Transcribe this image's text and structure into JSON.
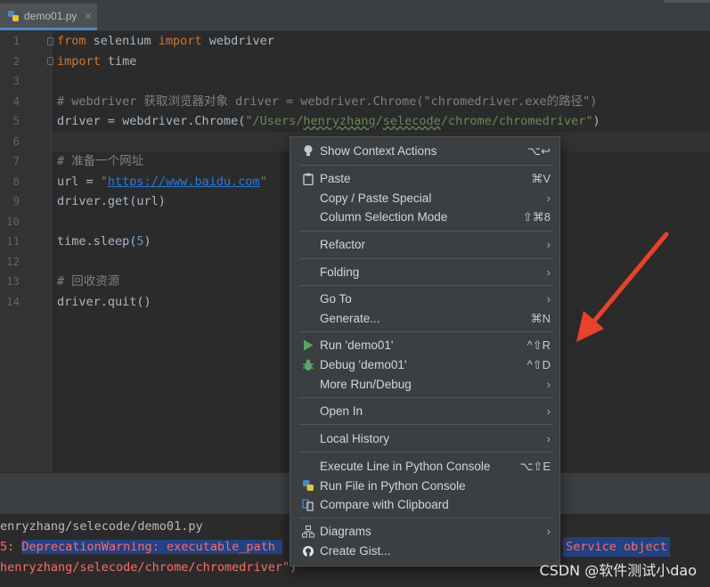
{
  "tab": {
    "filename": "demo01.py",
    "close": "×"
  },
  "lines": [
    "1",
    "2",
    "3",
    "4",
    "5",
    "6",
    "7",
    "8",
    "9",
    "10",
    "11",
    "12",
    "13",
    "14"
  ],
  "code": {
    "l1": {
      "kw1": "from",
      "mid": " selenium ",
      "kw2": "import",
      "rest": " webdriver"
    },
    "l2": {
      "kw1": "import",
      "rest": " time"
    },
    "l4": {
      "comment": "# webdriver 获取浏览器对象 driver = webdriver.Chrome(\"chromedriver.exe的路径\")"
    },
    "l5": {
      "pre": "driver = webdriver.Chrome(",
      "s1": "\"/Users/",
      "s2": "henryzhang",
      "s3": "/",
      "s4": "selecode",
      "s5": "/chrome/chromedriver\"",
      "post": ")"
    },
    "l7": {
      "comment": "# 准备一个网址"
    },
    "l8": {
      "pre": "url = ",
      "q1": "\"",
      "link": "https://www.baidu.com",
      "q2": "\""
    },
    "l9": {
      "text": "driver.get(url)"
    },
    "l11": {
      "pre": "time.sleep(",
      "num": "5",
      "post": ")"
    },
    "l13": {
      "comment": "# 回收资源"
    },
    "l14": {
      "text": "driver.quit()"
    }
  },
  "console": {
    "line1": "enryzhang/selecode/demo01.py",
    "line2_prefix": "5: ",
    "line2_sel": "DeprecationWarning: executable_path ",
    "line2_end": "Service object",
    "line3": "henryzhang/selecode/chrome/chromedriver\")"
  },
  "menu": {
    "items": [
      {
        "label": "Show Context Actions",
        "shortcut": "⌥↩",
        "icon": "bulb-icon"
      },
      {
        "label": "Paste",
        "shortcut": "⌘V",
        "icon": "clipboard-icon"
      },
      {
        "label": "Copy / Paste Special",
        "chevron": "›"
      },
      {
        "label": "Column Selection Mode",
        "shortcut": "⇧⌘8"
      },
      {
        "label": "Refactor",
        "chevron": "›"
      },
      {
        "label": "Folding",
        "chevron": "›"
      },
      {
        "label": "Go To",
        "chevron": "›"
      },
      {
        "label": "Generate...",
        "shortcut": "⌘N"
      },
      {
        "label": "Run 'demo01'",
        "shortcut": "^⇧R",
        "icon": "run-icon"
      },
      {
        "label": "Debug 'demo01'",
        "shortcut": "^⇧D",
        "icon": "debug-icon"
      },
      {
        "label": "More Run/Debug",
        "chevron": "›"
      },
      {
        "label": "Open In",
        "chevron": "›"
      },
      {
        "label": "Local History",
        "chevron": "›"
      },
      {
        "label": "Execute Line in Python Console",
        "shortcut": "⌥⇧E"
      },
      {
        "label": "Run File in Python Console",
        "icon": "python-icon"
      },
      {
        "label": "Compare with Clipboard",
        "icon": "compare-icon"
      },
      {
        "label": "Diagrams",
        "chevron": "›",
        "icon": "diagram-icon"
      },
      {
        "label": "Create Gist...",
        "icon": "github-icon"
      }
    ]
  },
  "watermark": "CSDN @软件测试小dao",
  "colors": {
    "accent_arrow": "#e8412c",
    "run_green": "#59a869",
    "keyword": "#cc7832",
    "string": "#6a8759",
    "link": "#287bde"
  }
}
